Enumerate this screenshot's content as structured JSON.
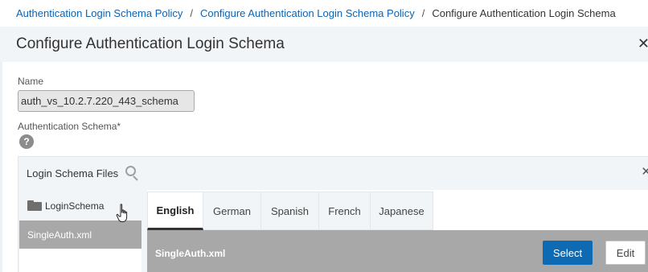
{
  "breadcrumb": {
    "items": [
      "Authentication Login Schema Policy",
      "Configure Authentication Login Schema Policy"
    ],
    "current": "Configure Authentication Login Schema",
    "separator": "/"
  },
  "panel": {
    "title": "Configure Authentication Login Schema",
    "close_icon": "close-icon"
  },
  "form": {
    "name_label": "Name",
    "name_value": "auth_vs_10.2.7.220_443_schema",
    "schema_label": "Authentication Schema*",
    "help_glyph": "?"
  },
  "files": {
    "header": "Login Schema Files",
    "folder": "LoginSchema",
    "selected_file": "SingleAuth.xml"
  },
  "preview": {
    "tabs": [
      "English",
      "German",
      "Spanish",
      "French",
      "Japanese"
    ],
    "active_tab": "English",
    "file_name": "SingleAuth.xml",
    "select_label": "Select",
    "edit_label": "Edit"
  },
  "colors": {
    "link": "#0e63b0",
    "primary_button": "#0f6ab4",
    "selected_row": "#a8a8a8",
    "header_bg": "#f2f5f8"
  }
}
